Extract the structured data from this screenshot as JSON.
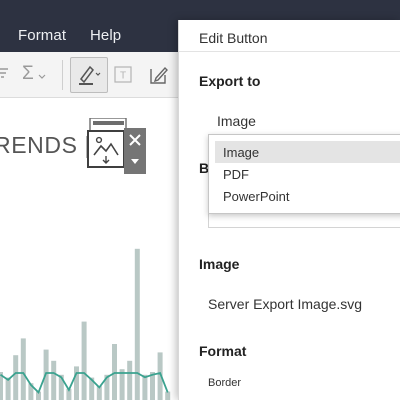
{
  "menubar": {
    "items": [
      "Format",
      "Help"
    ]
  },
  "toolbar": {
    "icons": [
      "sort-icon",
      "sum-icon",
      "highlight-pen-icon",
      "text-label-icon",
      "annotate-icon"
    ],
    "sum_symbol": "Σ"
  },
  "canvas": {
    "title_fragment": "RENDS |",
    "chart_data": {
      "type": "bar",
      "values": [
        10,
        8,
        16,
        22,
        6,
        3,
        18,
        14,
        9,
        4,
        12,
        28,
        8,
        5,
        9,
        20,
        11,
        14,
        54,
        9,
        10,
        17,
        3
      ],
      "line_overlay": true
    }
  },
  "panel": {
    "title": "Edit Button",
    "export_label": "Export to",
    "export_value": "Image",
    "hidden_label_fragment": "B",
    "image_label": "Image",
    "image_file": "Server Export Image.svg",
    "format_label": "Format",
    "border_label": "Border"
  },
  "dropdown": {
    "options": [
      "Image",
      "PDF",
      "PowerPoint"
    ],
    "selected": "Image"
  },
  "colors": {
    "menubar": "#2d3241",
    "bar": "#b9c8c5",
    "line": "#3aa28f"
  }
}
